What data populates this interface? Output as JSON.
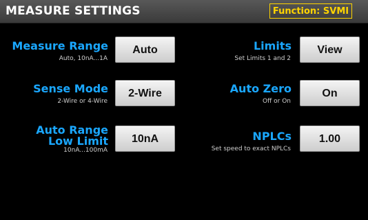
{
  "header": {
    "title": "MEASURE SETTINGS",
    "function_badge": "Function: SVMI"
  },
  "settings": {
    "measure_range": {
      "label": "Measure Range",
      "hint": "Auto, 10nA...1A",
      "value": "Auto"
    },
    "sense_mode": {
      "label": "Sense Mode",
      "hint": "2-Wire or 4-Wire",
      "value": "2-Wire"
    },
    "auto_range_low_limit": {
      "label_line1": "Auto Range",
      "label_line2": "Low Limit",
      "hint": "10nA...100mA",
      "value": "10nA"
    },
    "limits": {
      "label": "Limits",
      "hint": "Set Limits 1 and 2",
      "value": "View"
    },
    "auto_zero": {
      "label": "Auto Zero",
      "hint": "Off or On",
      "value": "On"
    },
    "nplcs": {
      "label": "NPLCs",
      "hint": "Set speed to exact NPLCs",
      "value": "1.00"
    }
  },
  "colors": {
    "label_blue": "#1aa7ff",
    "badge_yellow": "#ffd400",
    "header_gray": "#4a4a4a"
  }
}
